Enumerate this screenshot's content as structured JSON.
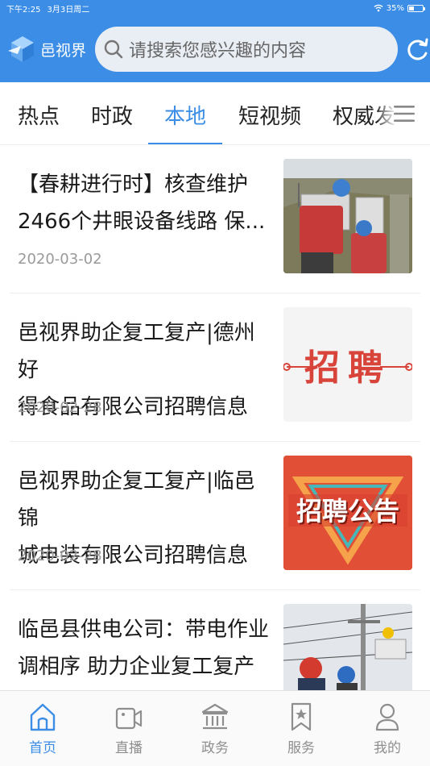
{
  "status_bar": {
    "time": "下午2:25",
    "date": "3月3日周二",
    "battery": "35%",
    "battery_level": 0.35
  },
  "header": {
    "logo_text": "邑视界",
    "search_placeholder": "请搜索您感兴趣的内容"
  },
  "tabs": [
    {
      "label": "热点",
      "active": false
    },
    {
      "label": "时政",
      "active": false
    },
    {
      "label": "本地",
      "active": true
    },
    {
      "label": "短视频",
      "active": false
    },
    {
      "label": "权威发布",
      "active": false
    }
  ],
  "feed": [
    {
      "title_lines": [
        "【春耕进行时】核查维护",
        "2466个井眼设备线路 保..."
      ],
      "date": "2020-03-02"
    },
    {
      "title_lines": [
        "邑视界助企复工复产|德州好",
        "得食品有限公司招聘信息"
      ],
      "date": "2020-02-28",
      "image_text": "招聘"
    },
    {
      "title_lines": [
        "邑视界助企复工复产|临邑锦",
        "城电装有限公司招聘信息"
      ],
      "date": "2020-02-28",
      "image_text": "招聘公告"
    },
    {
      "title_lines": [
        "临邑县供电公司：带电作业",
        "调相序 助力企业复工复产"
      ],
      "date": ""
    }
  ],
  "bottom_nav": [
    {
      "label": "首页",
      "icon": "home-icon",
      "active": true
    },
    {
      "label": "直播",
      "icon": "video-icon",
      "active": false
    },
    {
      "label": "政务",
      "icon": "government-icon",
      "active": false
    },
    {
      "label": "服务",
      "icon": "bookmark-star-icon",
      "active": false
    },
    {
      "label": "我的",
      "icon": "user-icon",
      "active": false
    }
  ],
  "colors": {
    "accent": "#3b8de6",
    "inactive": "#8e8e8e",
    "date": "#9a9a9a"
  }
}
